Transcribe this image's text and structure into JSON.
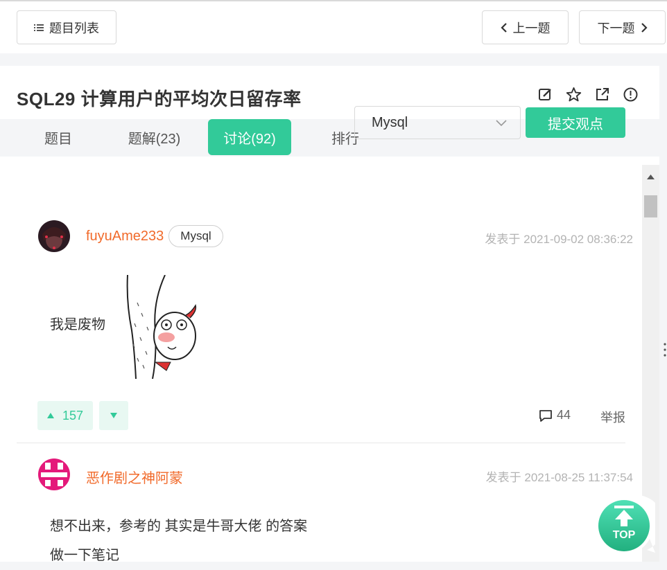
{
  "toolbar": {
    "list_label": "题目列表",
    "prev_label": "上一题",
    "next_label": "下一题"
  },
  "problem": {
    "title": "SQL29  计算用户的平均次日留存率",
    "icons": [
      "edit-icon",
      "star-icon",
      "share-icon",
      "report-icon"
    ]
  },
  "tabs": [
    {
      "label": "题目",
      "active": false
    },
    {
      "label": "题解(23)",
      "active": false
    },
    {
      "label": "讨论(92)",
      "active": true
    },
    {
      "label": "排行",
      "active": false
    }
  ],
  "filter": {
    "selected": "Mysql",
    "submit_label": "提交观点"
  },
  "posts": [
    {
      "username": "fuyuAme233",
      "tag": "Mysql",
      "time": "发表于 2021-09-02 08:36:22",
      "content": "我是废物",
      "upvotes": "157",
      "comments": "44",
      "report_label": "举报"
    },
    {
      "username": "恶作剧之神阿蒙",
      "time": "发表于 2021-08-25 11:37:54",
      "content_lines": [
        "想不出来，参考的 其实是牛哥大佬 的答案",
        "做一下笔记"
      ]
    }
  ],
  "top_button": "TOP",
  "colors": {
    "accent": "#32ca99",
    "username": "#f16a2a",
    "muted": "#b3b3b3"
  }
}
